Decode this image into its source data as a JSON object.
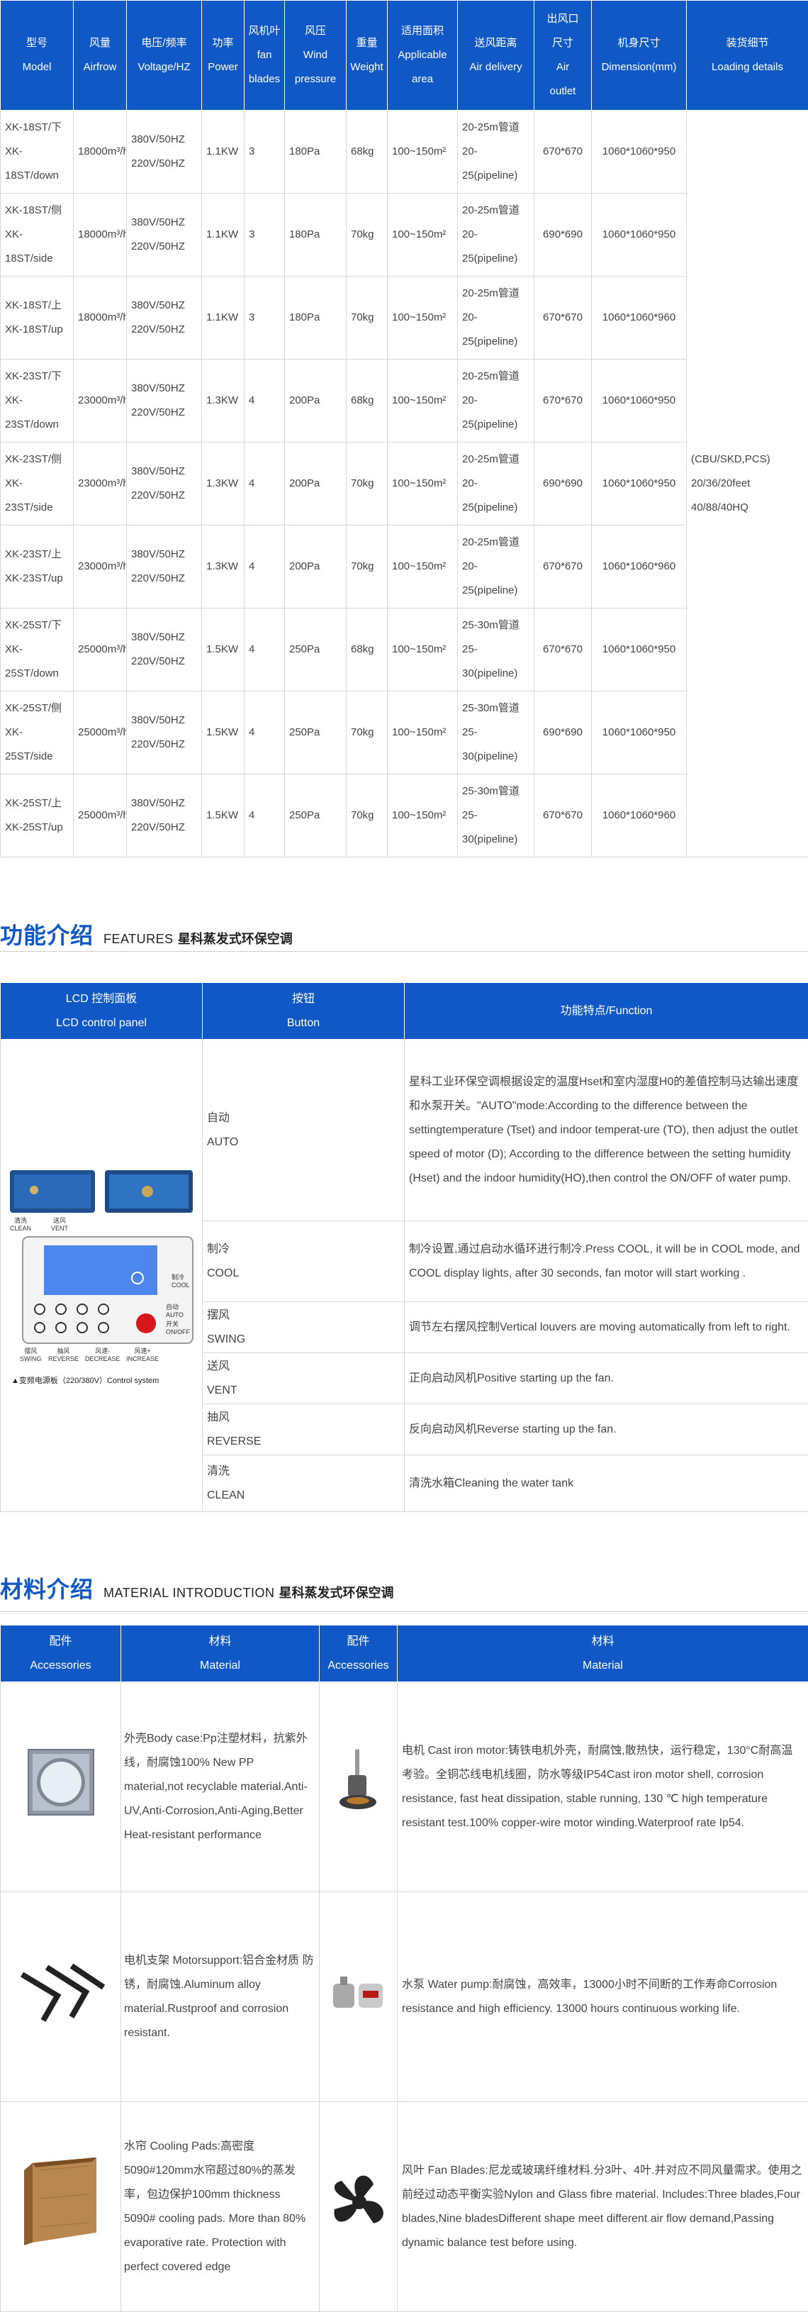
{
  "spec": {
    "headers": [
      [
        "型号",
        "Model"
      ],
      [
        "风量",
        "Airfrow"
      ],
      [
        "电压/频率",
        "Voltage/HZ"
      ],
      [
        "功率",
        "Power"
      ],
      [
        "风机叶",
        "fan",
        "blades"
      ],
      [
        "风压",
        "Wind",
        "pressure"
      ],
      [
        "重量",
        "Weight"
      ],
      [
        "适用面积",
        "Applicable",
        "area"
      ],
      [
        "送风距离",
        "Air delivery"
      ],
      [
        "出风口",
        "尺寸",
        "Air",
        "outlet"
      ],
      [
        "机身尺寸",
        "Dimension(mm)"
      ],
      [
        "装货细节",
        "Loading details"
      ]
    ],
    "rows": [
      {
        "model": "XK-18ST/下XK-18ST/down",
        "airflow": "18000m³/h",
        "voltage": "380V/50HZ 220V/50HZ",
        "power": "1.1KW",
        "blades": "3",
        "pressure": "180Pa",
        "weight": "68kg",
        "area": "100~150m²",
        "delivery": "20-25m管道20-25(pipeline)",
        "outlet": "670*670",
        "dimension": "1060*1060*950"
      },
      {
        "model": "XK-18ST/侧XK-18ST/side",
        "airflow": "18000m³/h",
        "voltage": "380V/50HZ 220V/50HZ",
        "power": "1.1KW",
        "blades": "3",
        "pressure": "180Pa",
        "weight": "70kg",
        "area": "100~150m²",
        "delivery": "20-25m管道20-25(pipeline)",
        "outlet": "690*690",
        "dimension": "1060*1060*950"
      },
      {
        "model": "XK-18ST/上XK-18ST/up",
        "airflow": "18000m³/h",
        "voltage": "380V/50HZ 220V/50HZ",
        "power": "1.1KW",
        "blades": "3",
        "pressure": "180Pa",
        "weight": "70kg",
        "area": "100~150m²",
        "delivery": "20-25m管道20-25(pipeline)",
        "outlet": "670*670",
        "dimension": "1060*1060*960"
      },
      {
        "model": "XK-23ST/下XK-23ST/down",
        "airflow": "23000m³/h",
        "voltage": "380V/50HZ 220V/50HZ",
        "power": "1.3KW",
        "blades": "4",
        "pressure": "200Pa",
        "weight": "68kg",
        "area": "100~150m²",
        "delivery": "20-25m管道20-25(pipeline)",
        "outlet": "670*670",
        "dimension": "1060*1060*950"
      },
      {
        "model": "XK-23ST/侧XK-23ST/side",
        "airflow": "23000m³/h",
        "voltage": "380V/50HZ 220V/50HZ",
        "power": "1.3KW",
        "blades": "4",
        "pressure": "200Pa",
        "weight": "70kg",
        "area": "100~150m²",
        "delivery": "20-25m管道20-25(pipeline)",
        "outlet": "690*690",
        "dimension": "1060*1060*950"
      },
      {
        "model": "XK-23ST/上XK-23ST/up",
        "airflow": "23000m³/h",
        "voltage": "380V/50HZ 220V/50HZ",
        "power": "1.3KW",
        "blades": "4",
        "pressure": "200Pa",
        "weight": "70kg",
        "area": "100~150m²",
        "delivery": "20-25m管道20-25(pipeline)",
        "outlet": "670*670",
        "dimension": "1060*1060*960"
      },
      {
        "model": "XK-25ST/下XK-25ST/down",
        "airflow": "25000m³/h",
        "voltage": "380V/50HZ 220V/50HZ",
        "power": "1.5KW",
        "blades": "4",
        "pressure": "250Pa",
        "weight": "68kg",
        "area": "100~150m²",
        "delivery": "25-30m管道25-30(pipeline)",
        "outlet": "670*670",
        "dimension": "1060*1060*950"
      },
      {
        "model": "XK-25ST/侧XK-25ST/side",
        "airflow": "25000m³/h",
        "voltage": "380V/50HZ 220V/50HZ",
        "power": "1.5KW",
        "blades": "4",
        "pressure": "250Pa",
        "weight": "70kg",
        "area": "100~150m²",
        "delivery": "25-30m管道25-30(pipeline)",
        "outlet": "690*690",
        "dimension": "1060*1060*950"
      },
      {
        "model": "XK-25ST/上XK-25ST/up",
        "airflow": "25000m³/h",
        "voltage": "380V/50HZ 220V/50HZ",
        "power": "1.5KW",
        "blades": "4",
        "pressure": "250Pa",
        "weight": "70kg",
        "area": "100~150m²",
        "delivery": "25-30m管道25-30(pipeline)",
        "outlet": "670*670",
        "dimension": "1060*1060*960"
      }
    ],
    "loading": "(CBU/SKD,PCS) 20/36/20feet 40/88/40HQ"
  },
  "features_title": {
    "cn": "功能介绍",
    "en": "FEATURES",
    "brand": "星科蒸发式环保空调"
  },
  "features": {
    "headers": [
      "LCD 控制面板",
      "LCD control panel",
      "按钮",
      "Button",
      "功能特点/Function"
    ],
    "panel": {
      "clean_cn": "清洗",
      "clean_en": "CLEAN",
      "vent_cn": "送风",
      "vent_en": "VENT",
      "cool_cn": "制冷",
      "cool_en": "COOL",
      "auto_cn": "自动",
      "auto_en": "AUTO",
      "onoff_cn": "开关",
      "onoff_en": "ON/OFF",
      "swing_cn": "摆风",
      "swing_en": "SWING",
      "reverse_cn": "抽风",
      "reverse_en": "REVERSE",
      "decrease_cn": "风速-",
      "decrease_en": "DECREASE",
      "increase_cn": "风速+",
      "increase_en": "INCREASE",
      "caption": "▲变频电源板（220/380V）Control system"
    },
    "rows": [
      {
        "btn_cn": "自动",
        "btn_en": "AUTO",
        "func": "星科工业环保空调根据设定的温度Hset和室内湿度H0的差值控制马达输出速度和水泵开关。\"AUTO\"mode:According to the difference between the settingtemperature (Tset) and indoor temperat-ure (TO), then adjust the outlet speed of motor (D); According to the difference between the setting humidity (Hset) and the indoor humidity(HO),then control the ON/OFF of water pump."
      },
      {
        "btn_cn": "制冷",
        "btn_en": "COOL",
        "func": "制冷设置,通过启动水循环进行制冷.Press COOL, it will be in COOL mode, and COOL display lights, after 30 seconds, fan motor will start working ."
      },
      {
        "btn_cn": "摆风",
        "btn_en": "SWING",
        "func": "调节左右摆风控制Vertical louvers are moving automatically from left to right."
      },
      {
        "btn_cn": "送风",
        "btn_en": "VENT",
        "func": "正向启动风机Positive starting up the fan."
      },
      {
        "btn_cn": "抽风",
        "btn_en": "REVERSE",
        "func": "反向启动风机Reverse starting up the fan."
      },
      {
        "btn_cn": "清洗",
        "btn_en": "CLEAN",
        "func": "清洗水箱Cleaning the water tank"
      }
    ]
  },
  "materials_title": {
    "cn": "材料介绍",
    "en": "MATERIAL INTRODUCTION",
    "brand": "星科蒸发式环保空调"
  },
  "materials": {
    "headers": [
      "配件",
      "Accessories",
      "材料",
      "Material",
      "配件",
      "Accessories",
      "材料",
      "Material"
    ],
    "rows": [
      {
        "left": "外壳Body case:Pp注塑材料，抗紫外线，耐腐蚀100% New PP material,not recyclable material.Anti-UV,Anti-Corrosion,Anti-Aging,Better Heat-resistant performance",
        "right": "电机 Cast iron motor:铸铁电机外壳，耐腐蚀,散热快，运行稳定，130°C耐高温考验。全铜芯线电机线圈，防水等级IP54Cast iron motor shell, corrosion resistance, fast heat dissipation, stable running, 130 ℃ high temperature resistant test.100% copper-wire motor winding.Waterproof rate Ip54."
      },
      {
        "left": "电机支架 Motorsupport:铝合金材质 防锈，耐腐蚀.Aluminum alloy material.Rustproof and corrosion resistant.",
        "right": "水泵 Water pump:耐腐蚀，高效率，13000小时不间断的工作寿命Corrosion resistance and high efficiency. 13000 hours continuous working life."
      },
      {
        "left": "水帘 Cooling Pads:高密度5090#120mm水帘超过80%的蒸发率，包边保护100mm thickness 5090# cooling pads. More than 80% evaporative rate. Protection with perfect covered edge",
        "right": "风叶 Fan Blades:尼龙或玻璃纤维材料.分3叶、4叶.并对应不同风量需求。使用之前经过动态平衡实验Nylon and Glass fibre material. Includes:Three blades,Four blades,Nine bladesDifferent shape meet different air flow demand,Passing dynamic balance test before using."
      }
    ]
  },
  "colors": {
    "accent": "#1058c6",
    "border": "#d6d6d6",
    "text": "#444444",
    "red_button": "#d8171b",
    "lcd": "#5b8ff0"
  }
}
